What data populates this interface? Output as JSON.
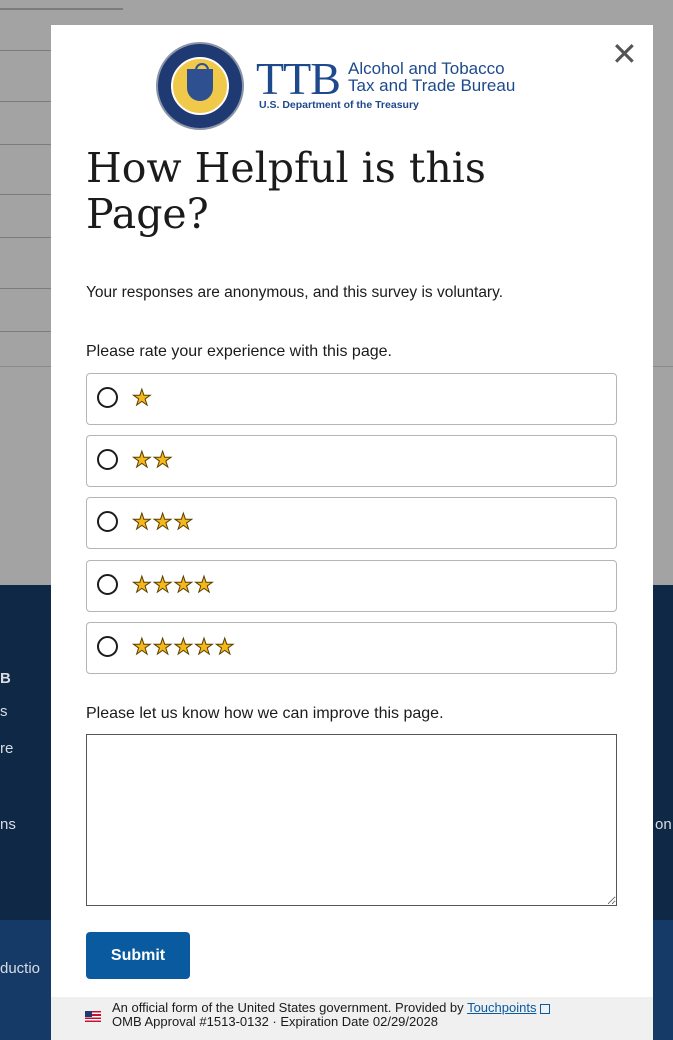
{
  "background": {
    "footer_fragments": [
      "B",
      "s",
      "re",
      "ns",
      "on",
      "ductio"
    ]
  },
  "modal": {
    "close_symbol": "✕",
    "logo": {
      "acronym": "TTB",
      "name_line1": "Alcohol and Tobacco",
      "name_line2": "Tax and Trade Bureau",
      "department": "U.S. Department of the Treasury"
    },
    "title": "How Helpful is this Page?",
    "anonymous_note": "Your responses are anonymous, and this survey is voluntary.",
    "rating_label": "Please rate your experience with this page.",
    "rating_options": [
      {
        "stars": "★",
        "value": 1
      },
      {
        "stars": "★★",
        "value": 2
      },
      {
        "stars": "★★★",
        "value": 3
      },
      {
        "stars": "★★★★",
        "value": 4
      },
      {
        "stars": "★★★★★",
        "value": 5
      }
    ],
    "improve_label": "Please let us know how we can improve this page.",
    "feedback_value": "",
    "submit_label": "Submit",
    "footer": {
      "line1_prefix": "An official form of the United States government. Provided by",
      "link_text": "Touchpoints",
      "line2": "OMB Approval #1513-0132 · Expiration Date 02/29/2028"
    }
  },
  "colors": {
    "accent": "#0a5aa0",
    "brand": "#1e4a8d",
    "star": "#f4b81c",
    "footer_dark": "#0f2846"
  }
}
